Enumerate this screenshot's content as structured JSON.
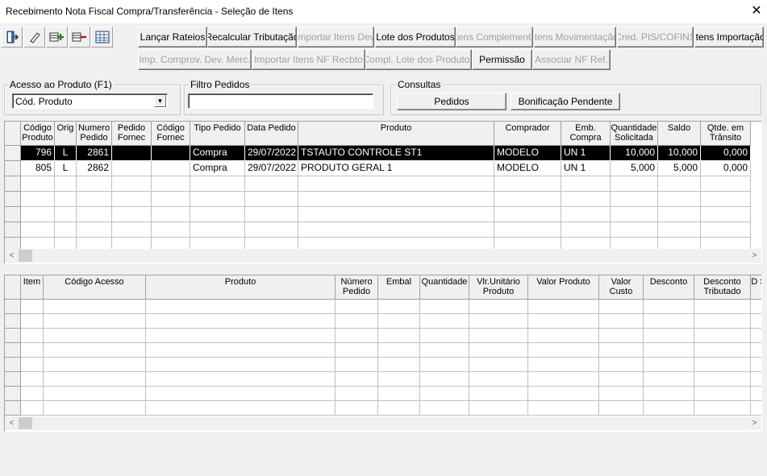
{
  "window": {
    "title": "Recebimento Nota Fiscal Compra/Transferência - Seleção de Itens",
    "close": "✕"
  },
  "toolbar": {
    "icons": [
      "exit-icon",
      "eraser-icon",
      "add-item-icon",
      "remove-item-icon",
      "grid-icon"
    ],
    "row1": [
      {
        "label": "Lançar Rateios",
        "enabled": true
      },
      {
        "label": "Recalcular Tributação",
        "enabled": true
      },
      {
        "label": "Importar Itens Dev.",
        "enabled": false
      },
      {
        "label": "Lote dos Produtos",
        "enabled": true
      },
      {
        "label": "Itens Complemento",
        "enabled": false
      },
      {
        "label": "Itens Movimentação",
        "enabled": false
      },
      {
        "label": "Cred. PIS/COFINS",
        "enabled": false
      },
      {
        "label": "Itens Importação",
        "enabled": true
      }
    ],
    "row2": [
      {
        "label": "Imp. Comprov. Dev. Merc.",
        "enabled": false
      },
      {
        "label": "Importar Itens NF Recbto",
        "enabled": false
      },
      {
        "label": "Compl. Lote dos Produtos",
        "enabled": false
      },
      {
        "label": "Permissão",
        "enabled": true
      },
      {
        "label": "Associar NF Ref.",
        "enabled": false
      }
    ]
  },
  "filters": {
    "acesso_label": "Acesso ao Produto (F1)",
    "acesso_value": "Cód. Produto",
    "pedidos_label": "Filtro Pedidos",
    "pedidos_value": "",
    "consultas_label": "Consultas",
    "btn_pedidos": "Pedidos",
    "btn_bonificacao": "Bonificação Pendente"
  },
  "orders": {
    "headers": [
      "Código Produto",
      "Orig",
      "Numero Pedido",
      "Pedido Fornec",
      "Código Fornec",
      "Tipo Pedido",
      "Data Pedido",
      "Produto",
      "Comprador",
      "Emb. Compra",
      "Quantidade Solicitada",
      "Saldo",
      "Qtde. em Trânsito"
    ],
    "rows": [
      [
        "796",
        "L",
        "2861",
        "",
        "",
        "Compra",
        "29/07/2022",
        "TSTAUTO CONTROLE ST1",
        "MODELO",
        "UN  1",
        "10,000",
        "10,000",
        "0,000"
      ],
      [
        "805",
        "L",
        "2862",
        "",
        "",
        "Compra",
        "29/07/2022",
        "PRODUTO GERAL 1",
        "MODELO",
        "UN  1",
        "5,000",
        "5,000",
        "0,000"
      ]
    ]
  },
  "items": {
    "headers": [
      "Item",
      "Código Acesso",
      "Produto",
      "Número Pedido",
      "Embal",
      "Quantidade",
      "Vlr.Unitário Produto",
      "Valor Produto",
      "Valor Custo",
      "Desconto",
      "Desconto Tributado",
      "D S"
    ],
    "rows": []
  }
}
